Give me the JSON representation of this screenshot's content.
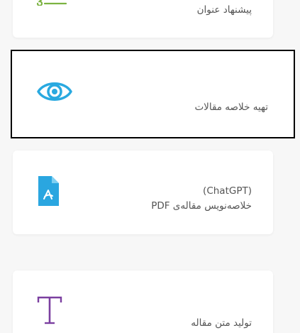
{
  "cards": [
    {
      "label": "پیشنهاد عنوان",
      "icon": "title-suggestion-icon"
    },
    {
      "label": "تهیه خلاصه مقالات",
      "icon": "eye-icon"
    },
    {
      "label_line1": "(ChatGPT)",
      "label_line2": "خلاصه‌نویس مقاله‌ی PDF",
      "icon": "pdf-file-icon"
    },
    {
      "label": "تولید متن مقاله",
      "icon": "text-t-icon"
    }
  ],
  "colors": {
    "title_icon": "#7cb342",
    "eye_icon": "#29a9e0",
    "pdf_icon": "#2aa6e0",
    "text_icon": "#7b3fa0",
    "selected_border": "#000000"
  }
}
